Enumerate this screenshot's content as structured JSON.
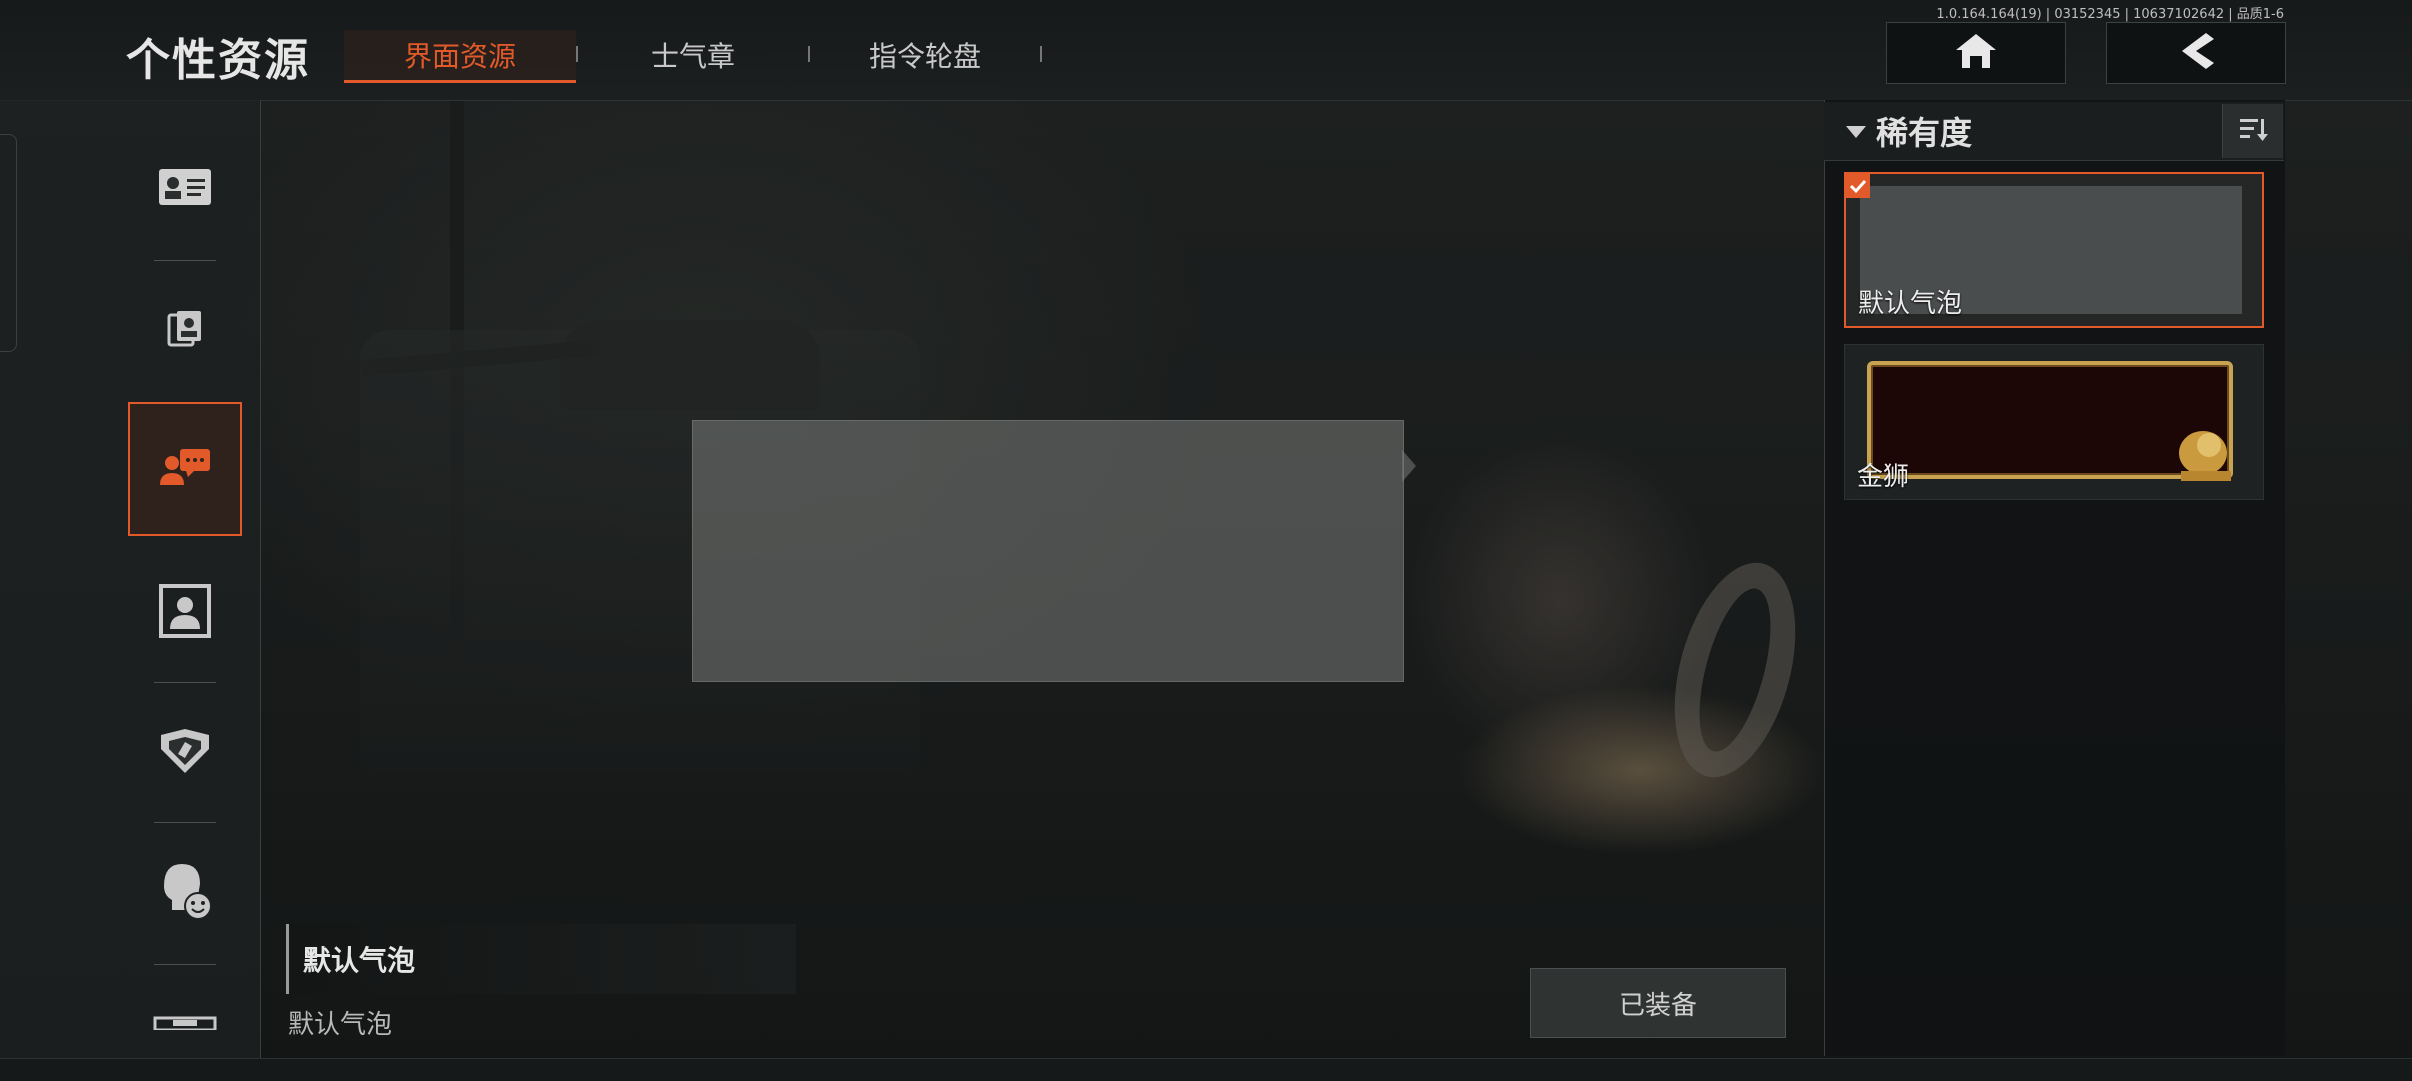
{
  "header": {
    "title": "个性资源",
    "tabs": [
      {
        "label": "界面资源",
        "active": true
      },
      {
        "label": "士气章",
        "active": false
      },
      {
        "label": "指令轮盘",
        "active": false
      }
    ],
    "version": "1.0.164.164(19) | 03152345 | 10637102642 | 品质1-6",
    "home_icon": "home-icon",
    "back_icon": "back-chevron-icon"
  },
  "sidebar": {
    "items": [
      {
        "icon": "id-card-icon",
        "active": false
      },
      {
        "icon": "photo-cards-icon",
        "active": false
      },
      {
        "icon": "chat-bubble-icon",
        "active": true
      },
      {
        "icon": "portrait-frame-icon",
        "active": false
      },
      {
        "icon": "badge-emblem-icon",
        "active": false
      },
      {
        "icon": "emote-head-icon",
        "active": false
      },
      {
        "icon": "nameplate-icon",
        "active": false
      }
    ]
  },
  "preview": {
    "item_name": "默认气泡",
    "item_subtitle": "默认气泡",
    "equip_label": "已装备"
  },
  "right_panel": {
    "filter_label": "稀有度",
    "cards": [
      {
        "name": "默认气泡",
        "selected": true,
        "equipped": true
      },
      {
        "name": "金狮",
        "selected": false,
        "equipped": false
      }
    ]
  },
  "colors": {
    "accent": "#e25a2a",
    "gold": "#c9a352"
  }
}
